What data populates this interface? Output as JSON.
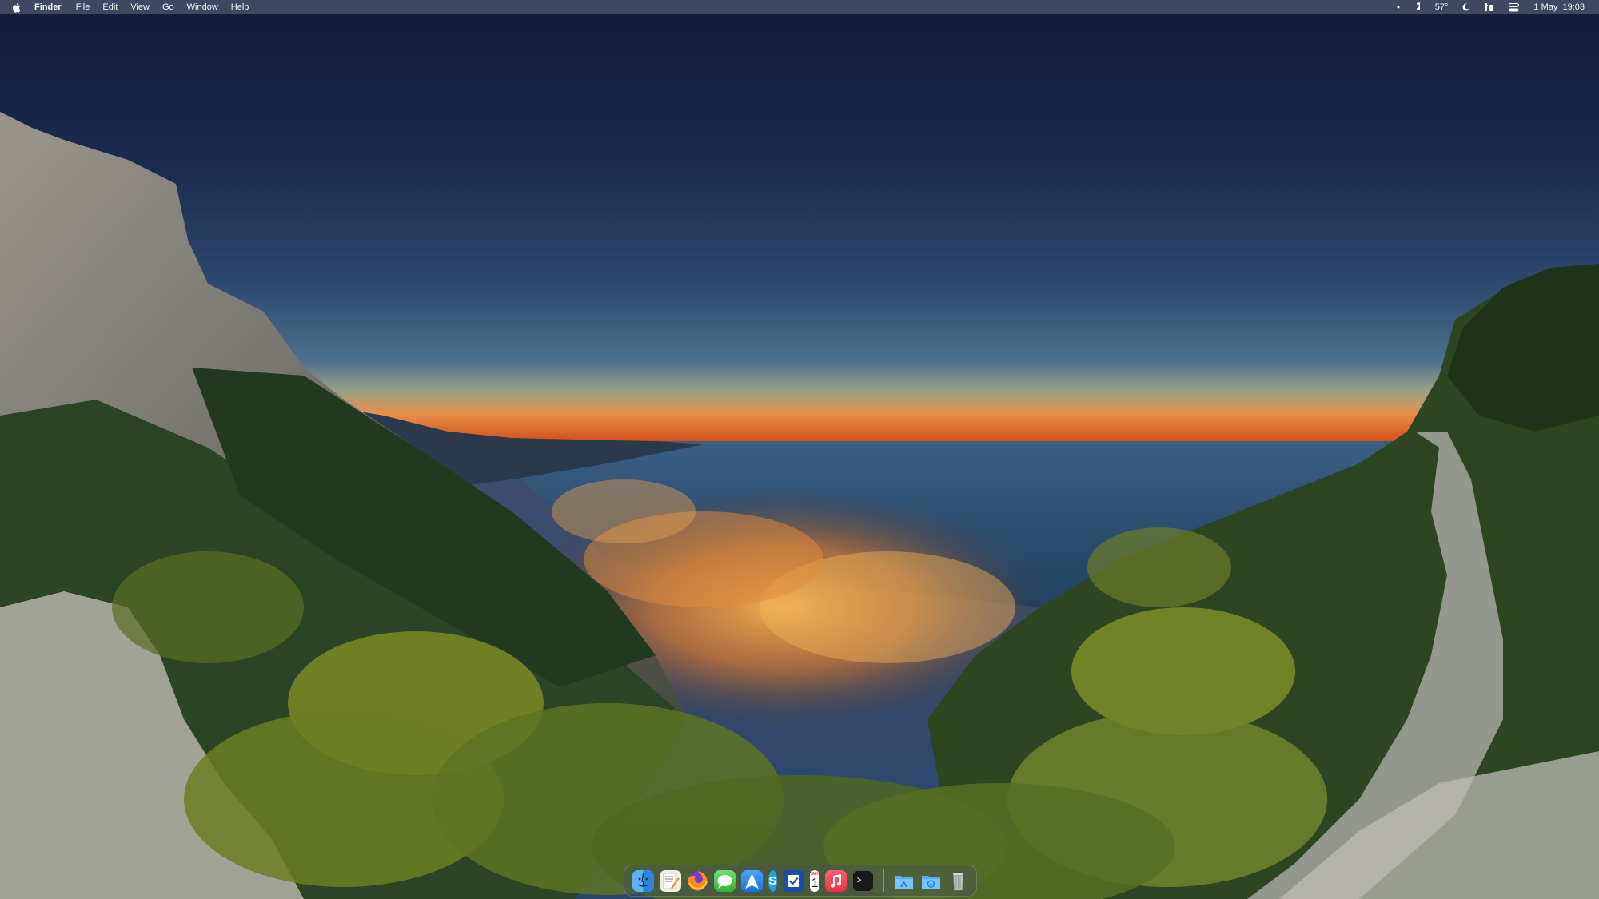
{
  "menubar": {
    "apple_icon": "apple-logo-icon",
    "app_name": "Finder",
    "menus": [
      "File",
      "Edit",
      "View",
      "Go",
      "Window",
      "Help"
    ],
    "status": {
      "dot_icon": "status-dot-icon",
      "music_icon": "music-note-icon",
      "temperature": "57°",
      "moon_icon": "moon-icon",
      "sliders_icon": "sliders-icon",
      "control_center_icon": "control-center-icon",
      "datetime": "1 May  19:03"
    }
  },
  "dock": {
    "apps": [
      {
        "name": "Finder",
        "icon": "finder-icon"
      },
      {
        "name": "TextEdit",
        "icon": "textedit-icon"
      },
      {
        "name": "Firefox",
        "icon": "firefox-icon"
      },
      {
        "name": "Messages",
        "icon": "messages-icon"
      },
      {
        "name": "Navigation",
        "icon": "arrow-icon"
      },
      {
        "name": "Skype",
        "icon": "skype-icon",
        "glyph": "S"
      },
      {
        "name": "Tasks",
        "icon": "checkmark-icon"
      },
      {
        "name": "Calendar",
        "icon": "calendar-icon",
        "month": "MAY",
        "day": "1"
      },
      {
        "name": "Music",
        "icon": "music-icon"
      },
      {
        "name": "Terminal",
        "icon": "terminal-icon"
      }
    ],
    "folders": [
      {
        "name": "Applications",
        "icon": "applications-folder-icon"
      },
      {
        "name": "Downloads",
        "icon": "downloads-folder-icon"
      },
      {
        "name": "Trash",
        "icon": "trash-icon"
      }
    ]
  },
  "colors": {
    "sky_top": "#16213f",
    "sky_horizon": "#d9521e",
    "sea": "#2c4d72",
    "foliage": "#2f4a24",
    "city_lights": "#f2a03c"
  }
}
